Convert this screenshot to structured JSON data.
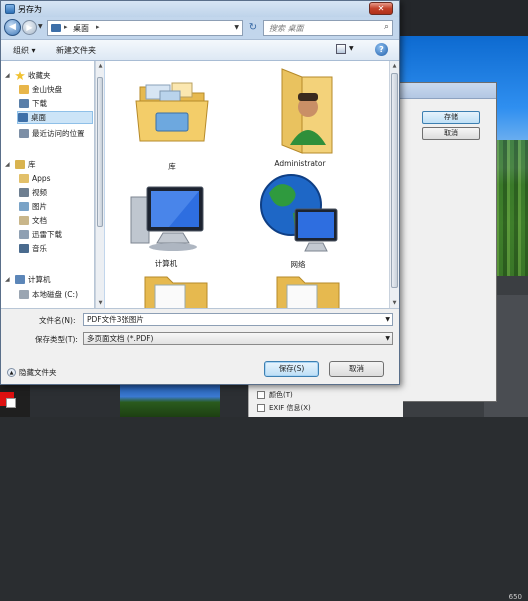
{
  "dialog": {
    "title": "另存为",
    "close_label": "✕",
    "address": {
      "path": "桌面",
      "sep": "▸"
    },
    "search": {
      "placeholder": "搜索 桌面"
    },
    "toolbar": {
      "organize": "组织 ▾",
      "new_folder": "新建文件夹",
      "help": "?"
    },
    "nav": {
      "favorites": "收藏夹",
      "fav_items": [
        "金山快盘",
        "下载",
        "桌面",
        "最近访问的位置"
      ],
      "libraries": "库",
      "lib_items": [
        "Apps",
        "视频",
        "图片",
        "文档",
        "迅雷下载",
        "音乐"
      ],
      "computer": "计算机",
      "comp_items": [
        "本地磁盘 (C:)"
      ]
    },
    "items": [
      {
        "label": "库",
        "icon": "library-folder-icon"
      },
      {
        "label": "Administrator",
        "icon": "user-folder-icon"
      },
      {
        "label": "计算机",
        "icon": "computer-icon"
      },
      {
        "label": "网络",
        "icon": "network-globe-icon"
      }
    ],
    "filename_label": "文件名(N):",
    "filename_value": "PDF文件3张图片",
    "savetype_label": "保存类型(T):",
    "savetype_value": "多页面文档 (*.PDF)",
    "hide_folders": "隐藏文件夹",
    "save_button": "保存(S)",
    "cancel_button": "取消"
  },
  "background": {
    "save_button": "存储",
    "cancel_button": "取消",
    "checkbox_1": "颜色(T)",
    "checkbox_2": "EXIF 信息(X)",
    "side_value": "650"
  }
}
